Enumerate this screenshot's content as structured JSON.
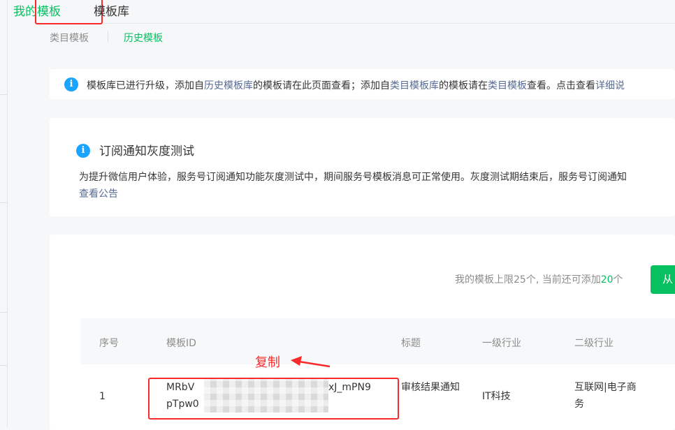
{
  "tabs": {
    "my_templates": "我的模板",
    "template_library": "模板库"
  },
  "subtabs": {
    "category_templates": "类目模板",
    "history_templates": "历史模板"
  },
  "notice": {
    "p1": "模板库已进行升级，添加自",
    "link1": "历史模板库",
    "p2": "的模板请在此页面查看；添加自",
    "link2": "类目模板库",
    "p3": "的模板请在",
    "link3": "类目模板",
    "p4": "查看。点击查看",
    "link4": "详细说"
  },
  "subscription": {
    "title": "订阅通知灰度测试",
    "description": "为提升微信用户体验，服务号订阅通知功能灰度测试中，期间服务号模板消息可正常使用。灰度测试期结束后，服务号订阅通知",
    "link": "查看公告"
  },
  "limit": {
    "prefix": "我的模板上限25个, 当前还可添加",
    "count": "20",
    "suffix": "个"
  },
  "add_button": "从",
  "table": {
    "headers": {
      "no": "序号",
      "id": "模板ID",
      "title": "标题",
      "industry1": "一级行业",
      "industry2": "二级行业"
    },
    "row": {
      "no": "1",
      "id_line1_start": "MRbV",
      "id_line1_end": "xJ_mPN9",
      "id_line2_start": "pTpw0",
      "title": "审核结果通知",
      "industry1": "IT科技",
      "industry2": "互联网|电子商务"
    }
  },
  "annotation": "复制",
  "colors": {
    "accent": "#07c160",
    "link": "#576b95",
    "annotation": "#fa2a2a",
    "info": "#1aa3ff"
  },
  "icons": {
    "notice": "info-icon",
    "subscription": "info-icon"
  }
}
